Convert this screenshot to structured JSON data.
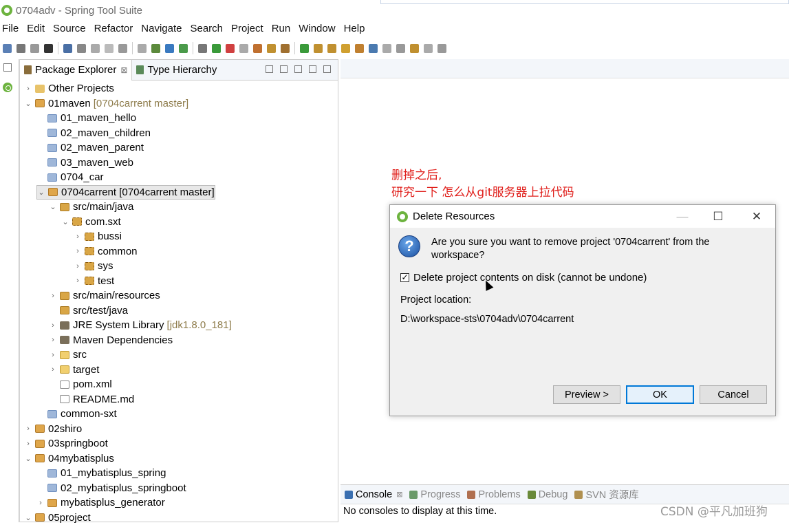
{
  "window": {
    "title": "0704adv - Spring Tool Suite"
  },
  "menu": [
    "File",
    "Edit",
    "Source",
    "Refactor",
    "Navigate",
    "Search",
    "Project",
    "Run",
    "Window",
    "Help"
  ],
  "package_explorer": {
    "tabs": [
      {
        "label": "Package Explorer",
        "close": "⊠"
      },
      {
        "label": "Type Hierarchy"
      }
    ],
    "tree": [
      {
        "label": "Other Projects",
        "deco": "",
        "indent": 0,
        "chev": ">",
        "icon": "folder"
      },
      {
        "label": "01maven",
        "deco": "[0704carrent master]",
        "indent": 0,
        "chev": "v",
        "icon": "proj"
      },
      {
        "label": "01_maven_hello",
        "deco": "",
        "indent": 1,
        "chev": "",
        "icon": "mod"
      },
      {
        "label": "02_maven_children",
        "deco": "",
        "indent": 1,
        "chev": "",
        "icon": "mod"
      },
      {
        "label": "02_maven_parent",
        "deco": "",
        "indent": 1,
        "chev": "",
        "icon": "mod"
      },
      {
        "label": "03_maven_web",
        "deco": "",
        "indent": 1,
        "chev": "",
        "icon": "mod"
      },
      {
        "label": "0704_car",
        "deco": "",
        "indent": 1,
        "chev": "",
        "icon": "mod"
      },
      {
        "label": "0704carrent [0704carrent master]",
        "deco": "",
        "indent": 1,
        "chev": "v",
        "icon": "proj",
        "selected": true
      },
      {
        "label": "src/main/java",
        "deco": "",
        "indent": 2,
        "chev": "v",
        "icon": "pkgroot"
      },
      {
        "label": "com.sxt",
        "deco": "",
        "indent": 3,
        "chev": "v",
        "icon": "pkg"
      },
      {
        "label": "bussi",
        "deco": "",
        "indent": 4,
        "chev": ">",
        "icon": "pkg"
      },
      {
        "label": "common",
        "deco": "",
        "indent": 4,
        "chev": ">",
        "icon": "pkg"
      },
      {
        "label": "sys",
        "deco": "",
        "indent": 4,
        "chev": ">",
        "icon": "pkg"
      },
      {
        "label": "test",
        "deco": "",
        "indent": 4,
        "chev": ">",
        "icon": "pkg"
      },
      {
        "label": "src/main/resources",
        "deco": "",
        "indent": 2,
        "chev": ">",
        "icon": "pkgroot"
      },
      {
        "label": "src/test/java",
        "deco": "",
        "indent": 2,
        "chev": "",
        "icon": "pkgroot"
      },
      {
        "label": "JRE System Library",
        "deco": "[jdk1.8.0_181]",
        "indent": 2,
        "chev": ">",
        "icon": "lib"
      },
      {
        "label": "Maven Dependencies",
        "deco": "",
        "indent": 2,
        "chev": ">",
        "icon": "lib"
      },
      {
        "label": "src",
        "deco": "",
        "indent": 2,
        "chev": ">",
        "icon": "folderp"
      },
      {
        "label": "target",
        "deco": "",
        "indent": 2,
        "chev": ">",
        "icon": "folderp"
      },
      {
        "label": "pom.xml",
        "deco": "",
        "indent": 2,
        "chev": "",
        "icon": "file"
      },
      {
        "label": "README.md",
        "deco": "",
        "indent": 2,
        "chev": "",
        "icon": "file"
      },
      {
        "label": "common-sxt",
        "deco": "",
        "indent": 1,
        "chev": "",
        "icon": "mod"
      },
      {
        "label": "02shiro",
        "deco": "",
        "indent": 0,
        "chev": ">",
        "icon": "proj"
      },
      {
        "label": "03springboot",
        "deco": "",
        "indent": 0,
        "chev": ">",
        "icon": "proj"
      },
      {
        "label": "04mybatisplus",
        "deco": "",
        "indent": 0,
        "chev": "v",
        "icon": "proj"
      },
      {
        "label": "01_mybatisplus_spring",
        "deco": "",
        "indent": 1,
        "chev": "",
        "icon": "mod"
      },
      {
        "label": "02_mybatisplus_springboot",
        "deco": "",
        "indent": 1,
        "chev": "",
        "icon": "mod"
      },
      {
        "label": "mybatisplus_generator",
        "deco": "",
        "indent": 1,
        "chev": ">",
        "icon": "proj"
      },
      {
        "label": "05project",
        "deco": "",
        "indent": 0,
        "chev": "v",
        "icon": "proj"
      }
    ]
  },
  "annotation": {
    "line1": "删掉之后,",
    "line2": "研究一下 怎么从git服务器上拉代码"
  },
  "dialog": {
    "title": "Delete Resources",
    "message": "Are you sure you want to remove project '0704carrent' from the workspace?",
    "checkbox_label": "Delete project contents on disk (cannot be undone)",
    "checkbox_checked": "✓",
    "location_label": "Project location:",
    "location_value": "D:\\workspace-sts\\0704adv\\0704carrent",
    "buttons": {
      "preview": "Preview >",
      "ok": "OK",
      "cancel": "Cancel"
    },
    "window_buttons": {
      "minimize": "—",
      "maximize": "☐",
      "close": "✕"
    }
  },
  "console": {
    "tabs": [
      {
        "label": "Console",
        "close": "⊠",
        "active": true
      },
      {
        "label": "Progress"
      },
      {
        "label": "Problems"
      },
      {
        "label": "Debug"
      },
      {
        "label": "SVN 资源库"
      }
    ],
    "message": "No consoles to display at this time."
  },
  "watermark": "CSDN @平凡加班狗"
}
